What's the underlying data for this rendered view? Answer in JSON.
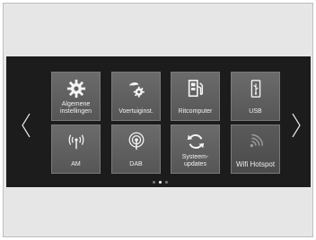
{
  "tiles": [
    {
      "label": "Algemene\ninstellingen",
      "icon": "gear-icon"
    },
    {
      "label": "Voertuiginst.",
      "icon": "vehicle-settings-icon"
    },
    {
      "label": "Ritcomputer",
      "icon": "fuel-pump-icon"
    },
    {
      "label": "USB",
      "icon": "usb-icon"
    },
    {
      "label": "AM",
      "icon": "antenna-icon"
    },
    {
      "label": "DAB",
      "icon": "dab-icon"
    },
    {
      "label": "Systeem-\nupdates",
      "icon": "refresh-icon"
    },
    {
      "label": "Wifi Hotspot",
      "icon": "wifi-icon"
    }
  ],
  "pagination": {
    "pages": 3,
    "current": 2
  },
  "colors": {
    "screen": "#1c1c1c",
    "tile": "#626262",
    "text": "#f2f2f2"
  }
}
